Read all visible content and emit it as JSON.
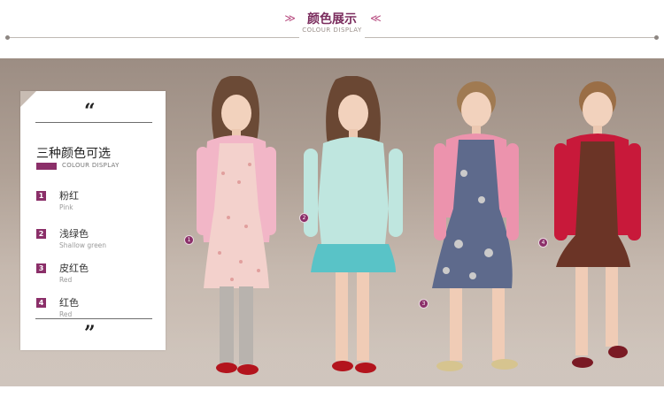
{
  "header": {
    "title": "颜色展示",
    "subtitle": "COLOUR DISPLAY",
    "arrow_left": "≫",
    "arrow_right": "≪"
  },
  "card": {
    "quote_open": "“",
    "quote_close": "”",
    "heading": "三种颜色可选",
    "sub_label": "COLOUR DISPLAY",
    "items": [
      {
        "num": "1",
        "name": "粉红",
        "en": "Pink"
      },
      {
        "num": "2",
        "name": "浅绿色",
        "en": "Shallow green"
      },
      {
        "num": "3",
        "name": "皮红色",
        "en": "Red"
      },
      {
        "num": "4",
        "name": "红色",
        "en": "Red"
      }
    ]
  },
  "markers": [
    "1",
    "2",
    "3",
    "4"
  ],
  "colors": {
    "accent": "#8b2f69",
    "pink_cardigan": "#f0b3c4",
    "green_cardigan": "#b9e2dc",
    "salmon_cardigan": "#e88aa6",
    "red_cardigan": "#c8193a"
  }
}
